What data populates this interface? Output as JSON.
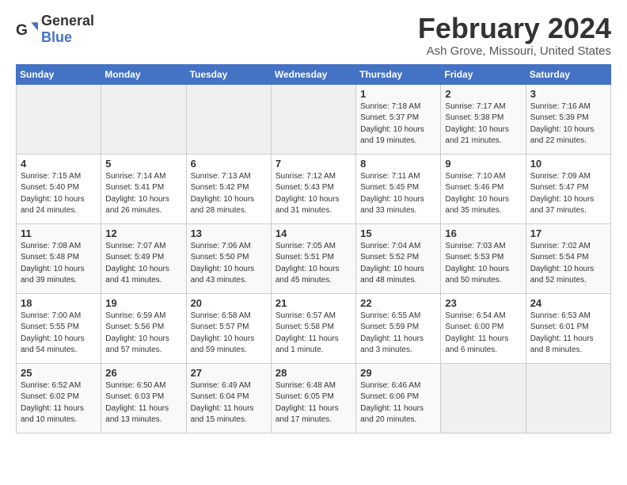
{
  "header": {
    "logo_general": "General",
    "logo_blue": "Blue",
    "title": "February 2024",
    "subtitle": "Ash Grove, Missouri, United States"
  },
  "days_of_week": [
    "Sunday",
    "Monday",
    "Tuesday",
    "Wednesday",
    "Thursday",
    "Friday",
    "Saturday"
  ],
  "weeks": [
    [
      {
        "day": "",
        "info": ""
      },
      {
        "day": "",
        "info": ""
      },
      {
        "day": "",
        "info": ""
      },
      {
        "day": "",
        "info": ""
      },
      {
        "day": "1",
        "info": "Sunrise: 7:18 AM\nSunset: 5:37 PM\nDaylight: 10 hours\nand 19 minutes."
      },
      {
        "day": "2",
        "info": "Sunrise: 7:17 AM\nSunset: 5:38 PM\nDaylight: 10 hours\nand 21 minutes."
      },
      {
        "day": "3",
        "info": "Sunrise: 7:16 AM\nSunset: 5:39 PM\nDaylight: 10 hours\nand 22 minutes."
      }
    ],
    [
      {
        "day": "4",
        "info": "Sunrise: 7:15 AM\nSunset: 5:40 PM\nDaylight: 10 hours\nand 24 minutes."
      },
      {
        "day": "5",
        "info": "Sunrise: 7:14 AM\nSunset: 5:41 PM\nDaylight: 10 hours\nand 26 minutes."
      },
      {
        "day": "6",
        "info": "Sunrise: 7:13 AM\nSunset: 5:42 PM\nDaylight: 10 hours\nand 28 minutes."
      },
      {
        "day": "7",
        "info": "Sunrise: 7:12 AM\nSunset: 5:43 PM\nDaylight: 10 hours\nand 31 minutes."
      },
      {
        "day": "8",
        "info": "Sunrise: 7:11 AM\nSunset: 5:45 PM\nDaylight: 10 hours\nand 33 minutes."
      },
      {
        "day": "9",
        "info": "Sunrise: 7:10 AM\nSunset: 5:46 PM\nDaylight: 10 hours\nand 35 minutes."
      },
      {
        "day": "10",
        "info": "Sunrise: 7:09 AM\nSunset: 5:47 PM\nDaylight: 10 hours\nand 37 minutes."
      }
    ],
    [
      {
        "day": "11",
        "info": "Sunrise: 7:08 AM\nSunset: 5:48 PM\nDaylight: 10 hours\nand 39 minutes."
      },
      {
        "day": "12",
        "info": "Sunrise: 7:07 AM\nSunset: 5:49 PM\nDaylight: 10 hours\nand 41 minutes."
      },
      {
        "day": "13",
        "info": "Sunrise: 7:06 AM\nSunset: 5:50 PM\nDaylight: 10 hours\nand 43 minutes."
      },
      {
        "day": "14",
        "info": "Sunrise: 7:05 AM\nSunset: 5:51 PM\nDaylight: 10 hours\nand 45 minutes."
      },
      {
        "day": "15",
        "info": "Sunrise: 7:04 AM\nSunset: 5:52 PM\nDaylight: 10 hours\nand 48 minutes."
      },
      {
        "day": "16",
        "info": "Sunrise: 7:03 AM\nSunset: 5:53 PM\nDaylight: 10 hours\nand 50 minutes."
      },
      {
        "day": "17",
        "info": "Sunrise: 7:02 AM\nSunset: 5:54 PM\nDaylight: 10 hours\nand 52 minutes."
      }
    ],
    [
      {
        "day": "18",
        "info": "Sunrise: 7:00 AM\nSunset: 5:55 PM\nDaylight: 10 hours\nand 54 minutes."
      },
      {
        "day": "19",
        "info": "Sunrise: 6:59 AM\nSunset: 5:56 PM\nDaylight: 10 hours\nand 57 minutes."
      },
      {
        "day": "20",
        "info": "Sunrise: 6:58 AM\nSunset: 5:57 PM\nDaylight: 10 hours\nand 59 minutes."
      },
      {
        "day": "21",
        "info": "Sunrise: 6:57 AM\nSunset: 5:58 PM\nDaylight: 11 hours\nand 1 minute."
      },
      {
        "day": "22",
        "info": "Sunrise: 6:55 AM\nSunset: 5:59 PM\nDaylight: 11 hours\nand 3 minutes."
      },
      {
        "day": "23",
        "info": "Sunrise: 6:54 AM\nSunset: 6:00 PM\nDaylight: 11 hours\nand 6 minutes."
      },
      {
        "day": "24",
        "info": "Sunrise: 6:53 AM\nSunset: 6:01 PM\nDaylight: 11 hours\nand 8 minutes."
      }
    ],
    [
      {
        "day": "25",
        "info": "Sunrise: 6:52 AM\nSunset: 6:02 PM\nDaylight: 11 hours\nand 10 minutes."
      },
      {
        "day": "26",
        "info": "Sunrise: 6:50 AM\nSunset: 6:03 PM\nDaylight: 11 hours\nand 13 minutes."
      },
      {
        "day": "27",
        "info": "Sunrise: 6:49 AM\nSunset: 6:04 PM\nDaylight: 11 hours\nand 15 minutes."
      },
      {
        "day": "28",
        "info": "Sunrise: 6:48 AM\nSunset: 6:05 PM\nDaylight: 11 hours\nand 17 minutes."
      },
      {
        "day": "29",
        "info": "Sunrise: 6:46 AM\nSunset: 6:06 PM\nDaylight: 11 hours\nand 20 minutes."
      },
      {
        "day": "",
        "info": ""
      },
      {
        "day": "",
        "info": ""
      }
    ]
  ]
}
